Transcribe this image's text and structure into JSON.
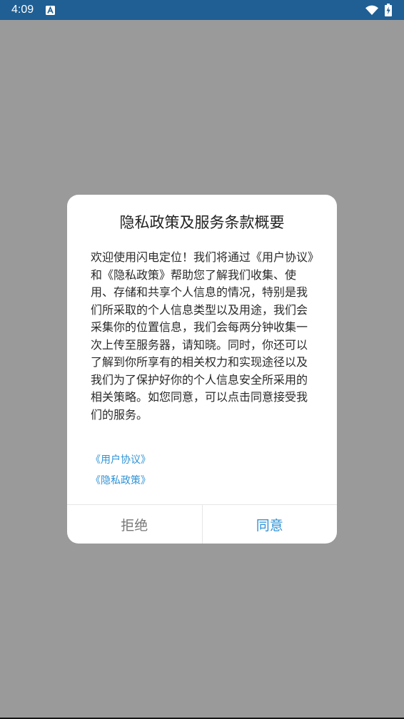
{
  "status_bar": {
    "time": "4:09",
    "background_color": "#1f5f94"
  },
  "dialog": {
    "title": "隐私政策及服务条款概要",
    "body": "欢迎使用闪电定位！我们将通过《用户协议》和《隐私政策》帮助您了解我们收集、使用、存储和共享个人信息的情况，特别是我们所采取的个人信息类型以及用途，我们会采集你的位置信息，我们会每两分钟收集一次上传至服务器，请知晓。同时，你还可以了解到你所享有的相关权力和实现途径以及我们为了保护好你的个人信息安全所采用的相关策略。如您同意，可以点击同意接受我们的服务。",
    "links": {
      "user_agreement": "《用户协议》",
      "privacy_policy": "《隐私政策》"
    },
    "buttons": {
      "reject": "拒绝",
      "agree": "同意"
    },
    "accent_color": "#2f93d6"
  },
  "icons": {
    "notification": "a-notification-icon",
    "wifi": "wifi-icon",
    "battery": "battery-charging-icon"
  }
}
